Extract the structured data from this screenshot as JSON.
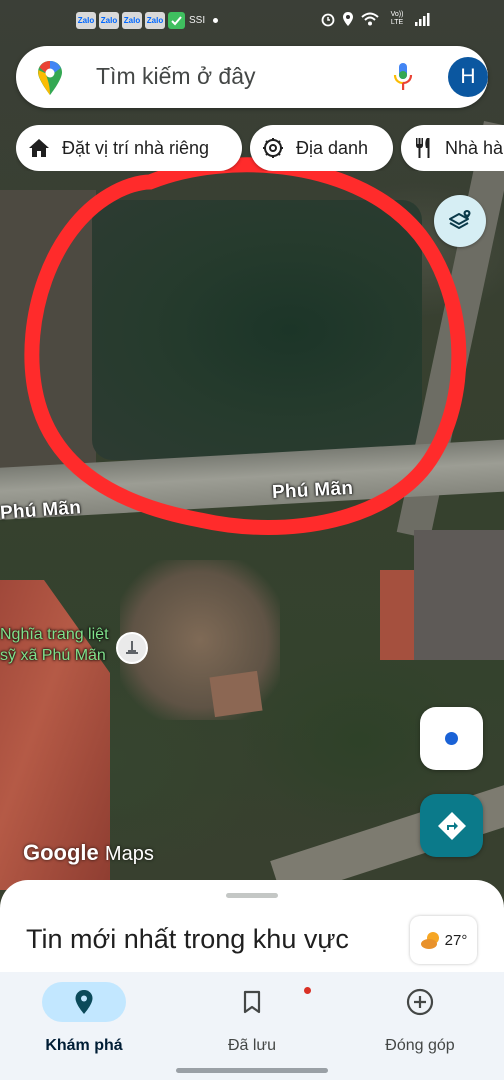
{
  "status_bar": {
    "apps": [
      "Zalo",
      "Zalo",
      "Zalo",
      "Zalo"
    ],
    "carrier_text": "SSI",
    "network_label": "Vo)) LTE"
  },
  "search": {
    "placeholder": "Tìm kiếm ở đây",
    "avatar_initial": "H"
  },
  "chips": [
    {
      "label": "Đặt vị trí nhà riêng",
      "icon": "home-icon"
    },
    {
      "label": "Địa danh",
      "icon": "landmark-icon"
    },
    {
      "label": "Nhà hàng",
      "icon": "restaurant-icon"
    }
  ],
  "map": {
    "road_labels": [
      "Phú Mãn",
      "Phú Mãn"
    ],
    "poi_label": "Nghĩa trang liệt sỹ xã Phú Mãn",
    "attribution": {
      "brand": "Google",
      "product": "Maps"
    },
    "annotation_color": "#ff2b2b"
  },
  "sheet": {
    "title": "Tin mới nhất trong khu vực",
    "weather_temp": "27°",
    "weather_icon": "partly-cloudy-icon"
  },
  "bottom_nav": [
    {
      "label": "Khám phá",
      "icon": "explore-pin-icon",
      "active": true
    },
    {
      "label": "Đã lưu",
      "icon": "bookmark-icon",
      "active": false
    },
    {
      "label": "Đóng góp",
      "icon": "add-circle-icon",
      "active": false
    }
  ],
  "colors": {
    "accent_blue": "#0b57a0",
    "directions_teal": "#0b7a8a",
    "nav_active_pill": "#c2e7ff"
  }
}
